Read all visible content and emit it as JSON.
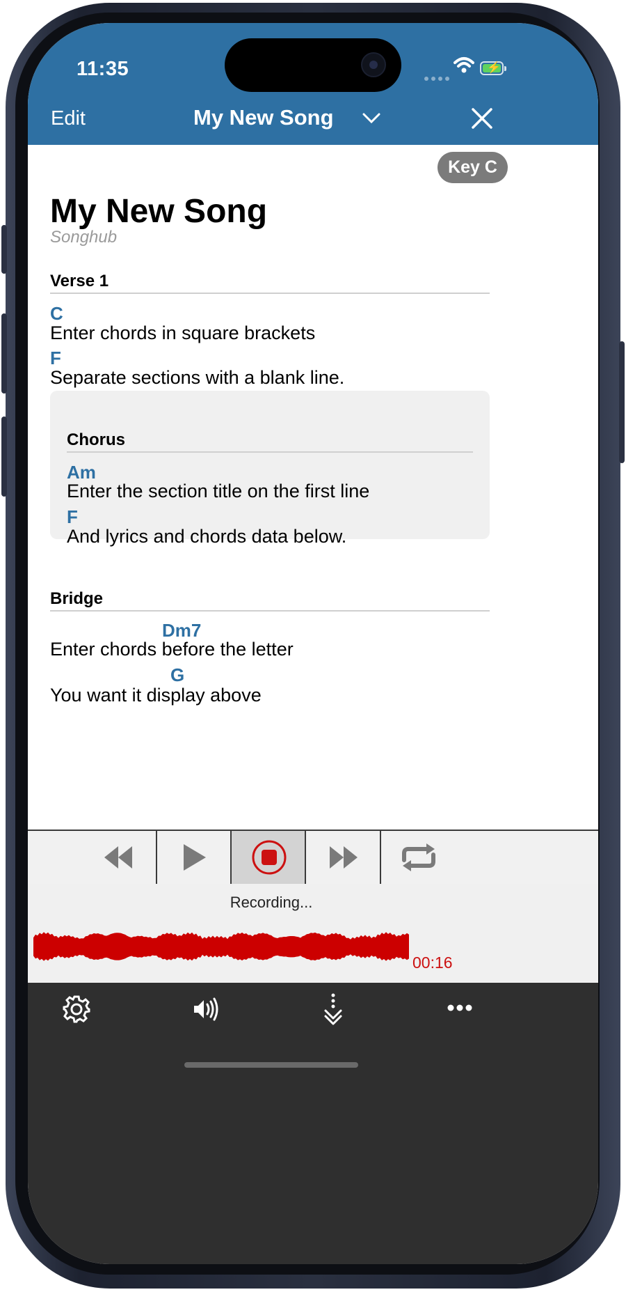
{
  "status_bar": {
    "time": "11:35"
  },
  "nav": {
    "edit_label": "Edit",
    "title": "My New Song",
    "title_chevron_icon": "chevron-down-icon",
    "close_icon": "close-icon"
  },
  "key_badge": "Key C",
  "song": {
    "title": "My New Song",
    "artist": "Songhub",
    "sections": [
      {
        "title": "Verse 1",
        "lines": [
          {
            "chord": "C",
            "lyric": "Enter chords in square brackets"
          },
          {
            "chord": "F",
            "lyric": "Separate sections with a blank line."
          }
        ]
      },
      {
        "title": "Chorus",
        "highlighted": true,
        "lines": [
          {
            "chord": "Am",
            "lyric": "Enter the section title on the first line"
          },
          {
            "chord": "F",
            "lyric": "And lyrics and chords data below."
          }
        ]
      },
      {
        "title": "Bridge",
        "lines": [
          {
            "chord": "Dm7",
            "lyric": "Enter chords before the letter"
          },
          {
            "chord": "G",
            "lyric": "You want it display above"
          }
        ]
      }
    ]
  },
  "transport": {
    "buttons": [
      "rewind",
      "play",
      "record-stop",
      "fast-forward",
      "repeat"
    ],
    "active": "record-stop"
  },
  "recording": {
    "status": "Recording...",
    "elapsed": "00:16"
  },
  "bottom_toolbar": {
    "icons": [
      "gear-icon",
      "speaker-icon",
      "scroll-down-icon",
      "more-icon"
    ]
  },
  "colors": {
    "header": "#2e70a3",
    "chord": "#2e70a3",
    "record": "#cc1111",
    "waveform": "#cc0000",
    "toolbar": "#2f2f2f"
  }
}
